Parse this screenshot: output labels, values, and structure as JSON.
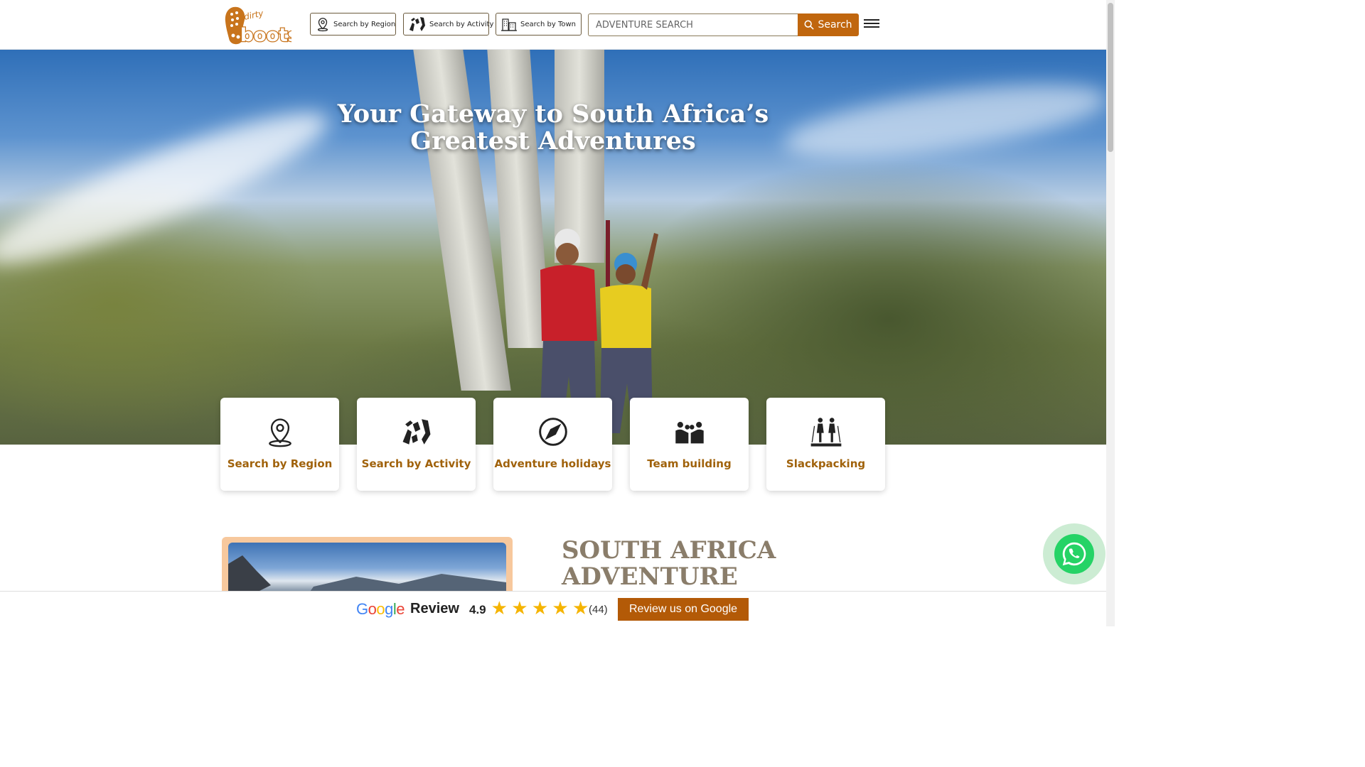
{
  "header": {
    "logo_alt": "dirty boots",
    "nav": {
      "region": "Search by Region",
      "activity": "Search by Activity",
      "town": "Search by Town"
    },
    "search": {
      "placeholder": "ADVENTURE SEARCH",
      "value": "",
      "button_label": "Search"
    }
  },
  "hero": {
    "title": "Your Gateway to South Africa’s Greatest Adventures"
  },
  "cards": [
    {
      "label": "Search by Region",
      "icon": "map-pin-icon"
    },
    {
      "label": "Search by Activity",
      "icon": "activity-icon"
    },
    {
      "label": "Adventure holidays",
      "icon": "compass-icon"
    },
    {
      "label": "Team building",
      "icon": "team-icon"
    },
    {
      "label": "Slackpacking",
      "icon": "hikers-icon"
    }
  ],
  "section": {
    "title": "SOUTH AFRICA ADVENTURE ACTIVITIES"
  },
  "review_bar": {
    "google_word": "Google",
    "review_word": "Review",
    "rating": "4.9",
    "stars": 5,
    "count": "(44)",
    "button_label": "Review us on Google"
  },
  "colors": {
    "accent": "#c0660e",
    "card_text": "#a0620b",
    "star": "#f5b400",
    "whatsapp": "#25d366"
  }
}
